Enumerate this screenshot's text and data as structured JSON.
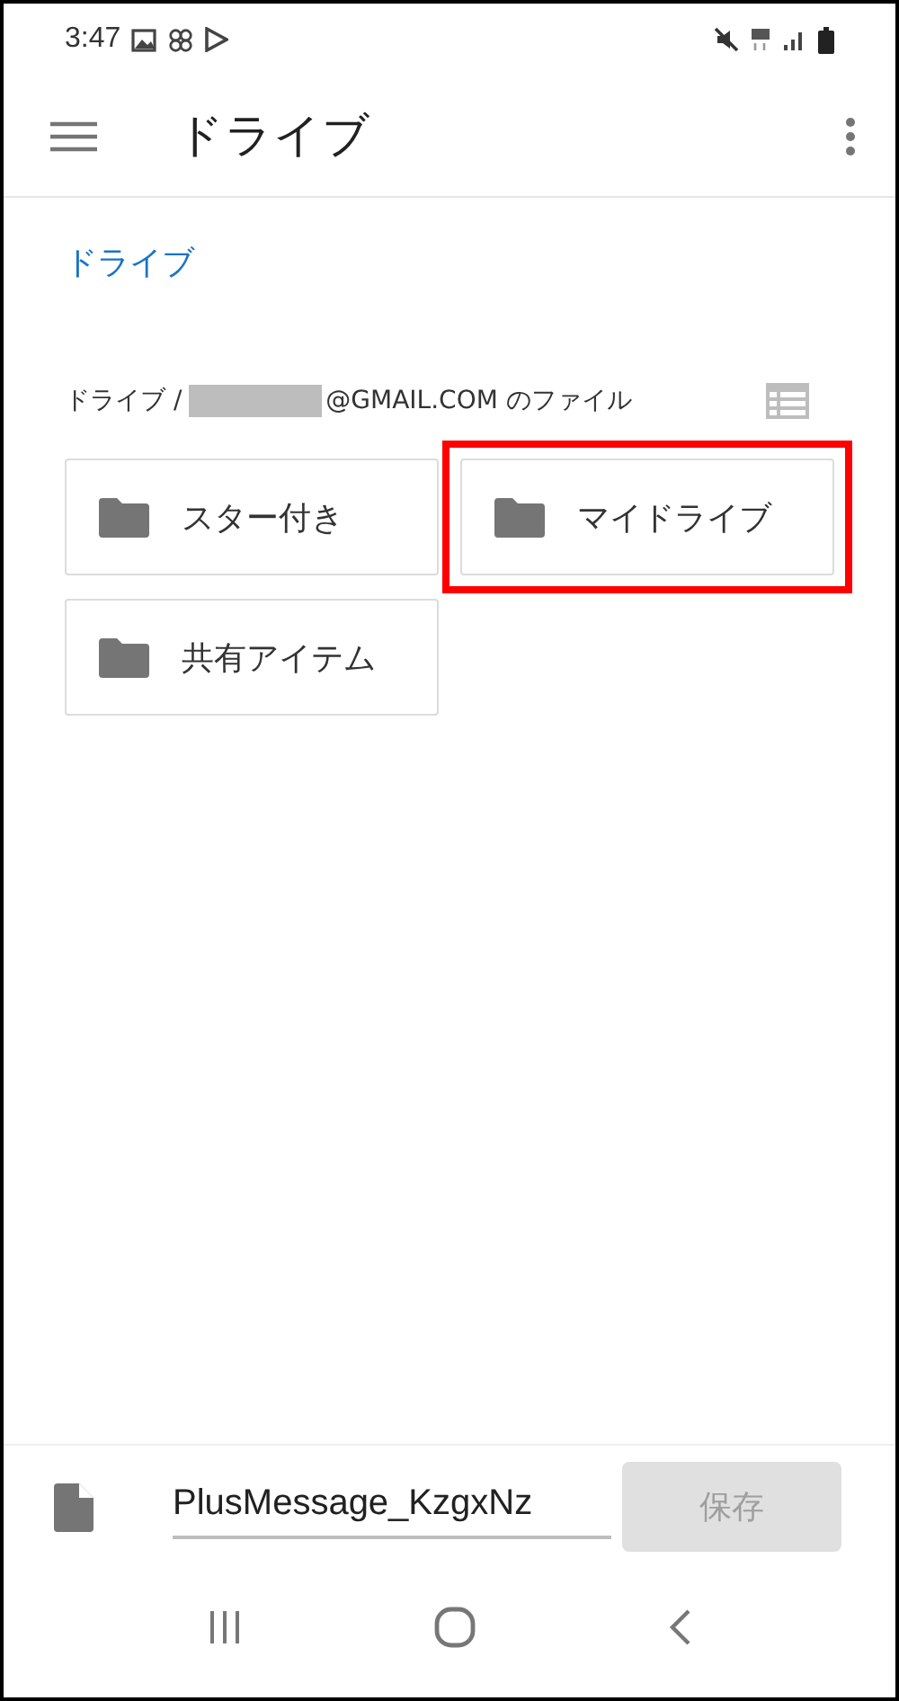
{
  "status_bar": {
    "time": "3:47"
  },
  "toolbar": {
    "title": "ドライブ"
  },
  "location_link": "ドライブ",
  "breadcrumb": {
    "prefix": "ドライブ /",
    "redacted": true,
    "suffix": "@GMAIL.COM のファイル"
  },
  "folders": [
    {
      "name": "スター付き",
      "highlighted": false
    },
    {
      "name": "マイドライブ",
      "highlighted": true
    },
    {
      "name": "共有アイテム",
      "highlighted": false
    }
  ],
  "save_bar": {
    "filename": "PlusMessage_KzgxNz",
    "button": "保存",
    "disabled": true
  }
}
